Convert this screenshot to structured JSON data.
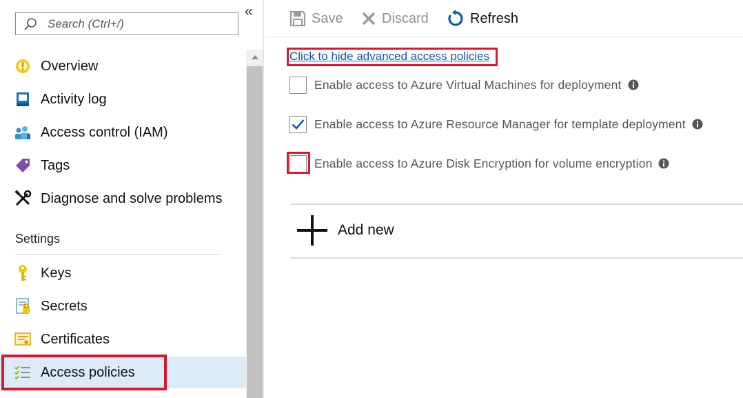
{
  "sidebar": {
    "search_placeholder": "Search (Ctrl+/)",
    "collapse_glyph": "«",
    "items_top": [
      {
        "label": "Overview",
        "icon": "overview-icon"
      },
      {
        "label": "Activity log",
        "icon": "activity-log-icon"
      },
      {
        "label": "Access control (IAM)",
        "icon": "iam-users-icon"
      },
      {
        "label": "Tags",
        "icon": "tag-icon"
      },
      {
        "label": "Diagnose and solve problems",
        "icon": "tools-icon"
      }
    ],
    "settings_heading": "Settings",
    "items_settings": [
      {
        "label": "Keys",
        "icon": "key-icon"
      },
      {
        "label": "Secrets",
        "icon": "secrets-icon"
      },
      {
        "label": "Certificates",
        "icon": "certificate-icon"
      },
      {
        "label": "Access policies",
        "icon": "access-policies-icon",
        "selected": true
      }
    ]
  },
  "toolbar": {
    "save_label": "Save",
    "discard_label": "Discard",
    "refresh_label": "Refresh"
  },
  "main": {
    "advanced_link": "Click to hide advanced access policies",
    "options": [
      {
        "label": "Enable access to Azure Virtual Machines for deployment",
        "checked": false
      },
      {
        "label": "Enable access to Azure Resource Manager for template deployment",
        "checked": true
      },
      {
        "label": "Enable access to Azure Disk Encryption for volume encryption",
        "checked": false
      }
    ],
    "add_new_label": "Add new"
  },
  "colors": {
    "accent": "#0a5aa8",
    "highlight_outline": "#d9182b",
    "selected_bg": "#dcebf8"
  }
}
